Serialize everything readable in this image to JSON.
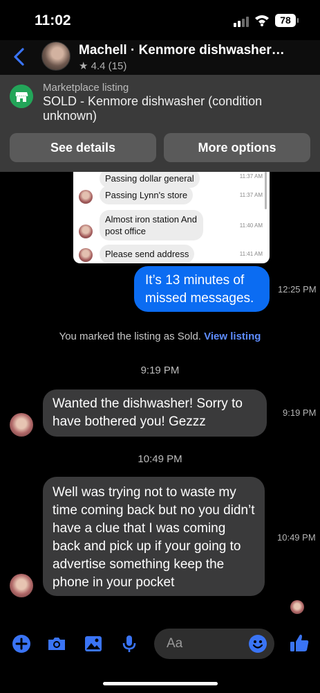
{
  "status_bar": {
    "time": "11:02",
    "battery": "78"
  },
  "header": {
    "title": "Machell · Kenmore dishwasher…",
    "rating": "★ 4.4 (15)"
  },
  "listing": {
    "label": "Marketplace listing",
    "title": "SOLD - Kenmore dishwasher (condition unknown)",
    "see_details": "See details",
    "more_options": "More options"
  },
  "screenshot": {
    "messages": [
      {
        "text": "Passing dollar general",
        "time": "11:37 AM"
      },
      {
        "text": "Passing Lynn's store",
        "time": "11:37 AM"
      },
      {
        "text": "Almost iron station  And post office",
        "time": "11:40 AM"
      },
      {
        "text": "Please send address",
        "time": "11:41 AM"
      }
    ]
  },
  "messages": {
    "outgoing_1": {
      "text": "It’s 13 minutes of missed messages.",
      "time": "12:25 PM"
    },
    "system": {
      "text": "You marked the listing as Sold.",
      "link": "View listing"
    },
    "stamp_1": "9:19 PM",
    "incoming_1": {
      "text": "Wanted the dishwasher! Sorry to have bothered you! Gezzz",
      "time": "9:19 PM"
    },
    "stamp_2": "10:49 PM",
    "incoming_2": {
      "text": "Well was trying not to waste my time coming back but no you didn’t have a clue that I was coming back and pick up if your going to advertise something keep the phone in your pocket",
      "time": "10:49 PM"
    }
  },
  "composer": {
    "placeholder": "Aa"
  },
  "colors": {
    "accent": "#0b6cf2",
    "icon_blue": "#3a74f5",
    "marketplace_green": "#23a559",
    "incoming_bubble": "#3a3a3b",
    "link": "#5e8dff"
  },
  "icons": [
    "back-arrow-icon",
    "store-icon",
    "plus-icon",
    "camera-icon",
    "gallery-icon",
    "microphone-icon",
    "emoji-icon",
    "thumbs-up-icon"
  ]
}
